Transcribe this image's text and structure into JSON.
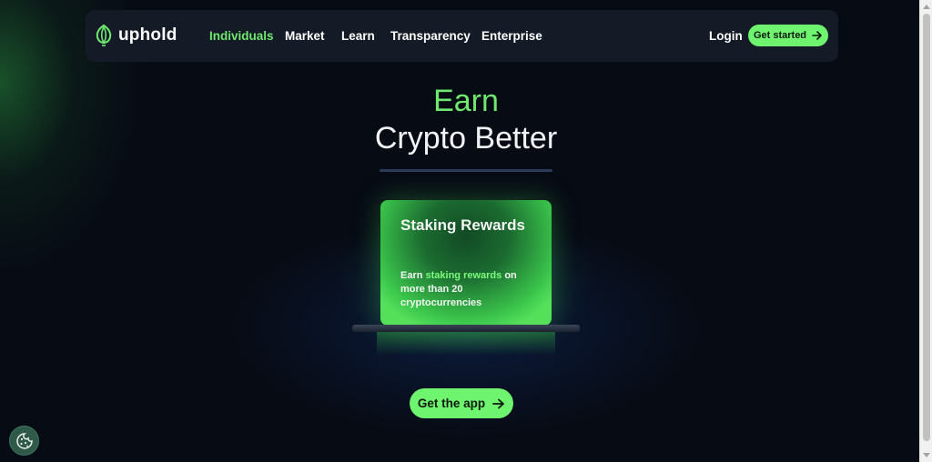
{
  "brand": {
    "name": "uphold",
    "logo_icon": "uphold-tulip-icon",
    "accent": "#6ff46f"
  },
  "nav": {
    "items": [
      {
        "label": "Individuals",
        "active": true
      },
      {
        "label": "Market",
        "active": false
      },
      {
        "label": "Learn",
        "active": false
      },
      {
        "label": "Transparency",
        "active": false
      },
      {
        "label": "Enterprise",
        "active": false
      }
    ],
    "login_label": "Login",
    "cta_label": "Get started",
    "cta_icon": "arrow-right-icon"
  },
  "hero": {
    "highlight": "Earn",
    "title": "Crypto Better"
  },
  "card": {
    "title": "Staking Rewards",
    "text_prefix": "Earn ",
    "text_highlight": "staking rewards",
    "text_suffix": " on more than 20 cryptocurrencies"
  },
  "app_button": {
    "label": "Get the app",
    "icon": "arrow-right-icon"
  },
  "cookie": {
    "icon": "cookie-icon"
  }
}
